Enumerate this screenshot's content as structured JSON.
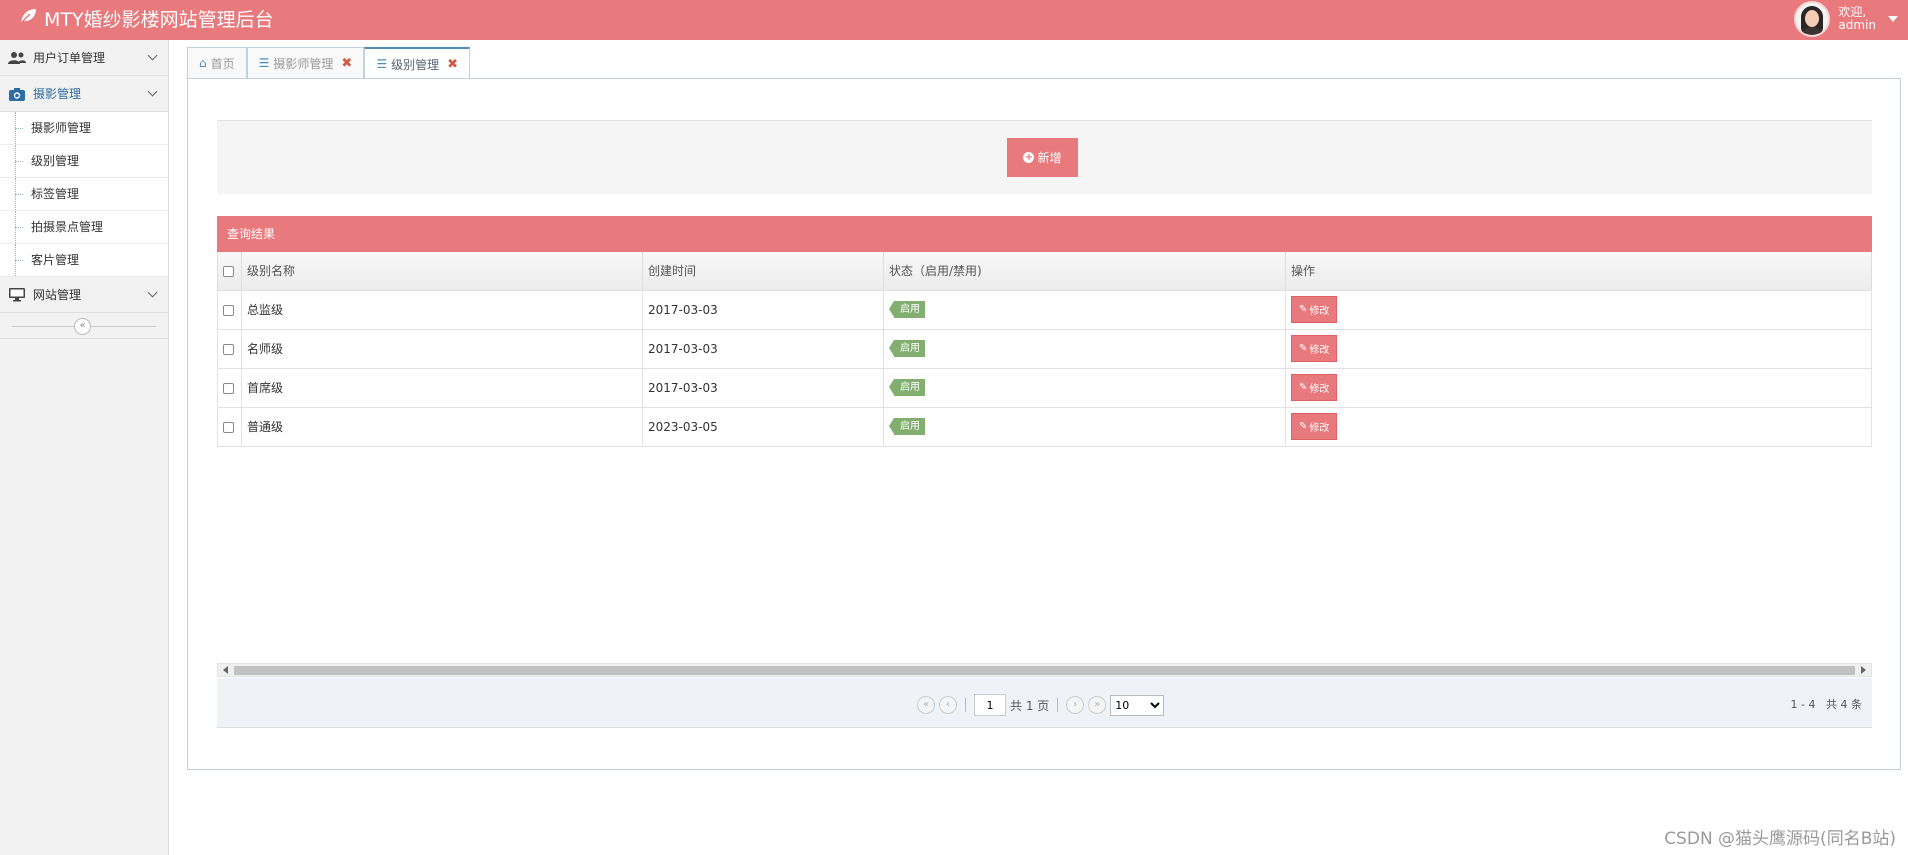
{
  "app": {
    "title": "MTY婚纱影楼网站管理后台"
  },
  "user": {
    "welcome": "欢迎,",
    "name": "admin"
  },
  "sidebar": {
    "groups": [
      {
        "label": "用户订单管理",
        "icon": "users-icon"
      },
      {
        "label": "摄影管理",
        "icon": "camera-icon"
      },
      {
        "label": "网站管理",
        "icon": "desktop-icon"
      }
    ],
    "sub_items": [
      "摄影师管理",
      "级别管理",
      "标签管理",
      "拍摄景点管理",
      "客片管理"
    ],
    "collapse_icon": "double-chevron-left-icon"
  },
  "tabs": [
    {
      "label": "首页",
      "icon": "home-icon"
    },
    {
      "label": "摄影师管理",
      "icon": "sliders-icon",
      "closable": true
    },
    {
      "label": "级别管理",
      "icon": "sliders-icon",
      "closable": true,
      "active": true
    }
  ],
  "toolbar": {
    "add_label": "新增"
  },
  "result": {
    "title": "查询结果",
    "columns": [
      "级别名称",
      "创建时间",
      "状态（启用/禁用)",
      "操作"
    ],
    "rows": [
      {
        "name": "总监级",
        "created": "2017-03-03",
        "status": "启用",
        "action": "修改"
      },
      {
        "name": "名师级",
        "created": "2017-03-03",
        "status": "启用",
        "action": "修改"
      },
      {
        "name": "首席级",
        "created": "2017-03-03",
        "status": "启用",
        "action": "修改"
      },
      {
        "name": "普通级",
        "created": "2023-03-05",
        "status": "启用",
        "action": "修改"
      }
    ]
  },
  "pager": {
    "page": "1",
    "total_pages_text": "共 1 页",
    "page_size": "10",
    "range_text": "1 - 4",
    "total_text": "共 4 条"
  },
  "watermark": "CSDN @猫头鹰源码(同名B站)",
  "colors": {
    "accent": "#e8797c",
    "badge": "#82af6f",
    "link": "#2e6da4"
  }
}
